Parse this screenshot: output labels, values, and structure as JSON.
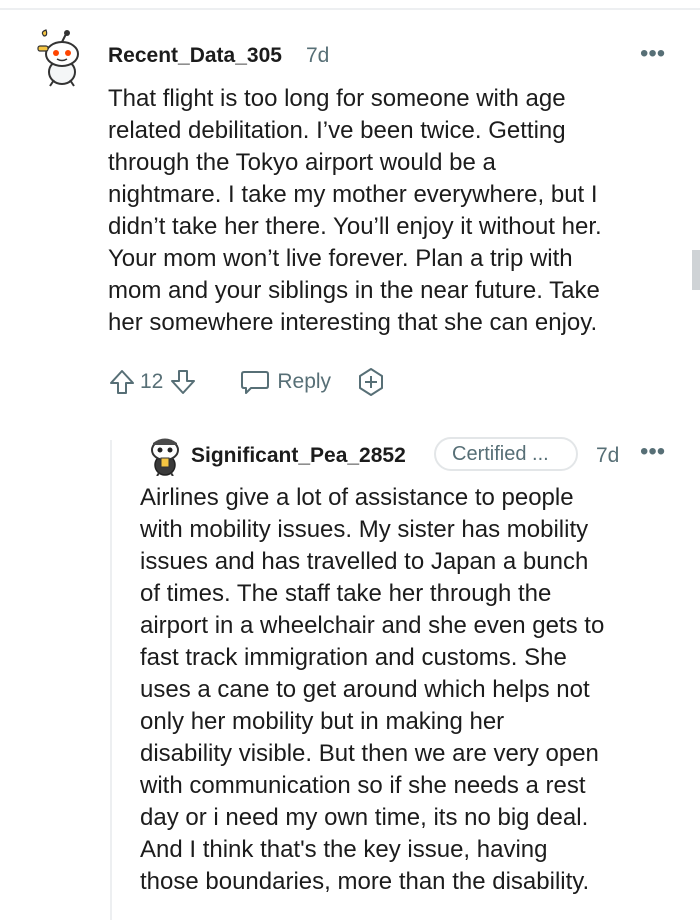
{
  "comment": {
    "username": "Recent_Data_305",
    "age": "7d",
    "more": "•••",
    "body_lines": [
      "That flight is too long for someone with age",
      "related debilitation. I’ve been twice. Getting",
      "through the Tokyo airport would be a",
      "nightmare. I take my mother everywhere, but I",
      "didn’t take her there. You’ll enjoy it without her.",
      "Your mom won’t live forever. Plan a trip with",
      "mom and your siblings in the near future. Take",
      "her somewhere interesting that she can enjoy."
    ],
    "score": "12",
    "reply_label": "Reply"
  },
  "reply": {
    "username": "Significant_Pea_2852",
    "flair": "Certified ...",
    "age": "7d",
    "more": "•••",
    "body_lines": [
      "Airlines give a lot of assistance to people",
      "with mobility issues. My sister has mobility",
      "issues and has travelled to Japan a bunch",
      "of times. The staff take her through the",
      "airport in a wheelchair and she even gets to",
      "fast track immigration and customs. She",
      "uses a cane to get around which helps not",
      "only her mobility but in making her",
      "disability visible. But then we are very open",
      "with communication so if she needs a rest",
      "day or i need my own time, its no big deal.",
      "And I think that's the key issue, having",
      "those boundaries, more than the disability."
    ]
  },
  "icons": {
    "upvote": "upvote-arrow-icon",
    "downvote": "downvote-arrow-icon",
    "reply": "speech-bubble-icon",
    "award": "award-plus-icon",
    "more": "ellipsis-icon"
  },
  "colors": {
    "text": "#1c1c1c",
    "meta": "#576f76",
    "divider": "#edeff1"
  }
}
